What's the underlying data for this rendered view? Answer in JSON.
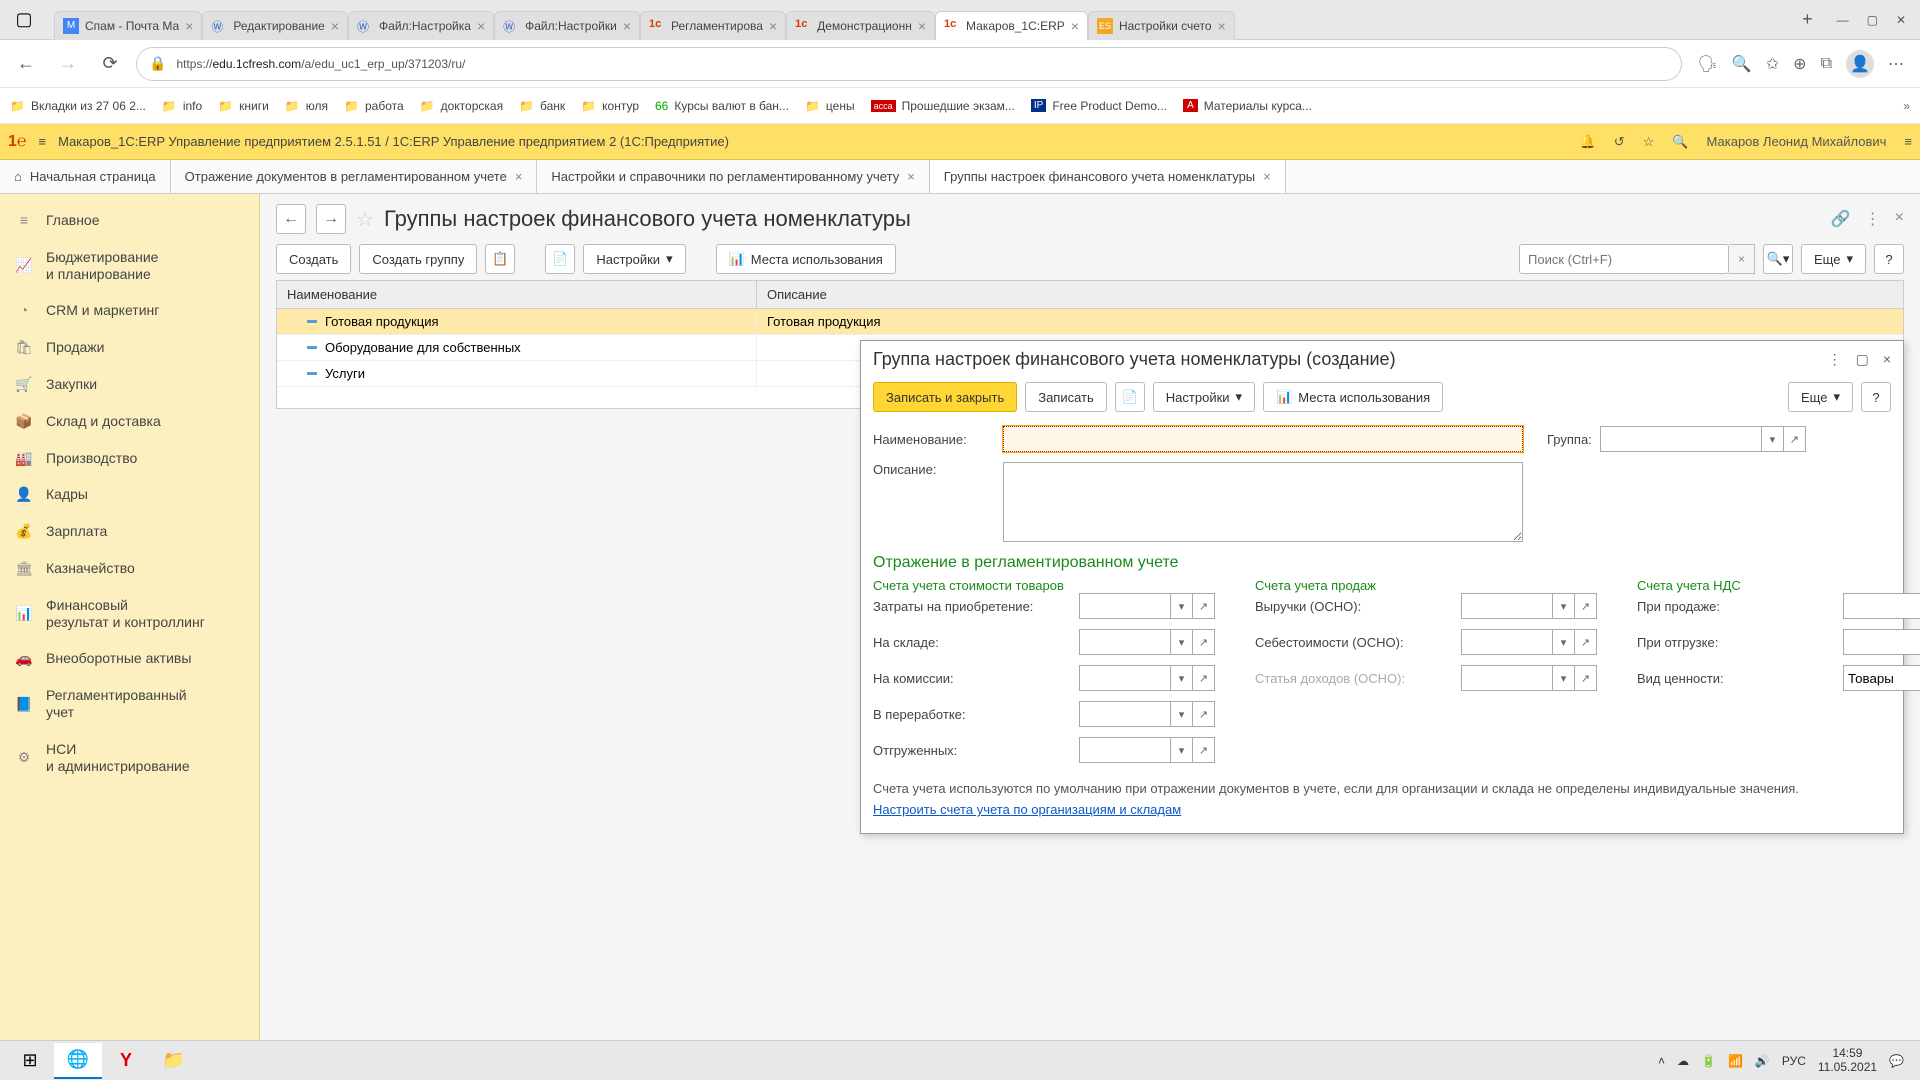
{
  "browser_tabs": [
    {
      "label": "Спам - Почта Ма",
      "favicon": "M"
    },
    {
      "label": "Редактирование",
      "favicon": "W"
    },
    {
      "label": "Файл:Настройка",
      "favicon": "W"
    },
    {
      "label": "Файл:Настройки",
      "favicon": "W"
    },
    {
      "label": "Регламентирова",
      "favicon": "1c"
    },
    {
      "label": "Демонстрационн",
      "favicon": "1c"
    },
    {
      "label": "Макаров_1С:ERP",
      "favicon": "1c",
      "active": true
    },
    {
      "label": "Настройки счето",
      "favicon": "ES"
    }
  ],
  "url": {
    "prefix": "https://",
    "domain": "edu.1cfresh.com",
    "path": "/a/edu_uc1_erp_up/371203/ru/"
  },
  "bookmarks": [
    "Вкладки из 27 06 2...",
    "info",
    "книги",
    "юля",
    "работа",
    "докторская",
    "банк",
    "контур",
    "Курсы валют в бан...",
    "цены",
    "Прошедшие экзам...",
    "Free Product Demo...",
    "Материалы курса..."
  ],
  "app_header": {
    "title": "Макаров_1С:ERP Управление предприятием 2.5.1.51 / 1С:ERP Управление предприятием 2   (1С:Предприятие)",
    "user": "Макаров Леонид Михайлович"
  },
  "app_tabs": {
    "home": "Начальная страница",
    "items": [
      "Отражение документов в регламентированном учете",
      "Настройки и справочники по регламентированному учету",
      "Группы настроек финансового учета номенклатуры"
    ]
  },
  "sidebar": [
    "Главное",
    "Бюджетирование\nи планирование",
    "CRM и маркетинг",
    "Продажи",
    "Закупки",
    "Склад и доставка",
    "Производство",
    "Кадры",
    "Зарплата",
    "Казначейство",
    "Финансовый\nрезультат и контроллинг",
    "Внеоборотные активы",
    "Регламентированный\nучет",
    "НСИ\nи администрирование"
  ],
  "page": {
    "title": "Группы настроек финансового учета номенклатуры",
    "toolbar": {
      "create": "Создать",
      "create_group": "Создать группу",
      "settings": "Настройки",
      "usage": "Места использования",
      "search_ph": "Поиск (Ctrl+F)",
      "more": "Еще"
    },
    "table": {
      "col1": "Наименование",
      "col2": "Описание",
      "rows": [
        {
          "name": "Готовая продукция",
          "desc": "Готовая продукция",
          "sel": true
        },
        {
          "name": "Оборудование для собственных",
          "desc": ""
        },
        {
          "name": "Услуги",
          "desc": ""
        }
      ]
    }
  },
  "modal": {
    "title": "Группа настроек финансового учета номенклатуры (создание)",
    "toolbar": {
      "save_close": "Записать и закрыть",
      "save": "Записать",
      "settings": "Настройки",
      "usage": "Места использования",
      "more": "Еще"
    },
    "fields": {
      "name": "Наименование:",
      "group": "Группа:",
      "desc": "Описание:"
    },
    "section": "Отражение в регламентированном учете",
    "cols": {
      "c1": {
        "title": "Счета учета стоимости товаров",
        "rows": [
          "Затраты на приобретение:",
          "На складе:",
          "На комиссии:",
          "В переработке:",
          "Отгруженных:"
        ]
      },
      "c2": {
        "title": "Счета учета продаж",
        "rows": [
          "Выручки (ОСНО):",
          "Себестоимости (ОСНО):",
          "Статья доходов (ОСНО):"
        ],
        "gray_idx": 2
      },
      "c3": {
        "title": "Счета учета НДС",
        "rows": [
          "При продаже:",
          "При отгрузке:",
          "Вид ценности:"
        ],
        "value_last": "Товары"
      }
    },
    "footer": "Счета учета используются по умолчанию при отражении документов в учете, если для организации и склада не определены индивидуальные значения.",
    "link": "Настроить счета учета по организациям и складам"
  },
  "tray": {
    "lang": "РУС",
    "time": "14:59",
    "date": "11.05.2021"
  }
}
